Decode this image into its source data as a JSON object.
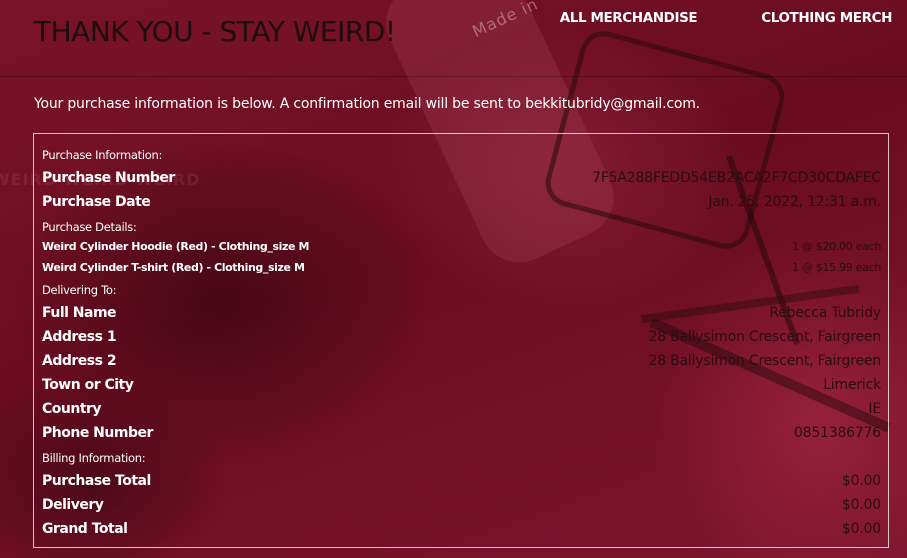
{
  "header": {
    "title": "THANK YOU - STAY WEIRD!",
    "nav": [
      "ALL MERCHANDISE",
      "CLOTHING MERCH"
    ]
  },
  "notice": "Your purchase information is below. A confirmation email will be sent to bekkitubridy@gmail.com.",
  "purchase_information": {
    "heading": "Purchase Information:",
    "number_label": "Purchase Number",
    "number": "7F5A288FEDD54EB2ACA2F7CD30CDAFEC",
    "date_label": "Purchase Date",
    "date": "Jan. 25, 2022, 12:31 a.m."
  },
  "purchase_details": {
    "heading": "Purchase Details:",
    "items": [
      {
        "name": "Weird Cylinder Hoodie (Red) - Clothing_size M",
        "qty": "1 @ $20.00 each"
      },
      {
        "name": "Weird Cylinder T-shirt (Red) - Clothing_size M",
        "qty": "1 @ $15.99 each"
      }
    ]
  },
  "delivery": {
    "heading": "Delivering To:",
    "fields": [
      {
        "label": "Full Name",
        "value": "Rebecca Tubridy"
      },
      {
        "label": "Address 1",
        "value": "28 Ballysimon Crescent, Fairgreen"
      },
      {
        "label": "Address 2",
        "value": "28 Ballysimon Crescent, Fairgreen"
      },
      {
        "label": "Town or City",
        "value": "Limerick"
      },
      {
        "label": "Country",
        "value": "IE"
      },
      {
        "label": "Phone Number",
        "value": "0851386776"
      }
    ]
  },
  "billing": {
    "heading": "Billing Information:",
    "fields": [
      {
        "label": "Purchase Total",
        "value": "$0.00"
      },
      {
        "label": "Delivery",
        "value": "$0.00"
      },
      {
        "label": "Grand Total",
        "value": "$0.00"
      }
    ]
  },
  "background": {
    "mic_text": "Made in",
    "ghost_text": "WEIRD WEIRD WEIRD"
  },
  "colors": {
    "background": "#6d0e22",
    "title": "#1b0d10",
    "text": "#ffffff",
    "value_text": "#2a0c14"
  }
}
